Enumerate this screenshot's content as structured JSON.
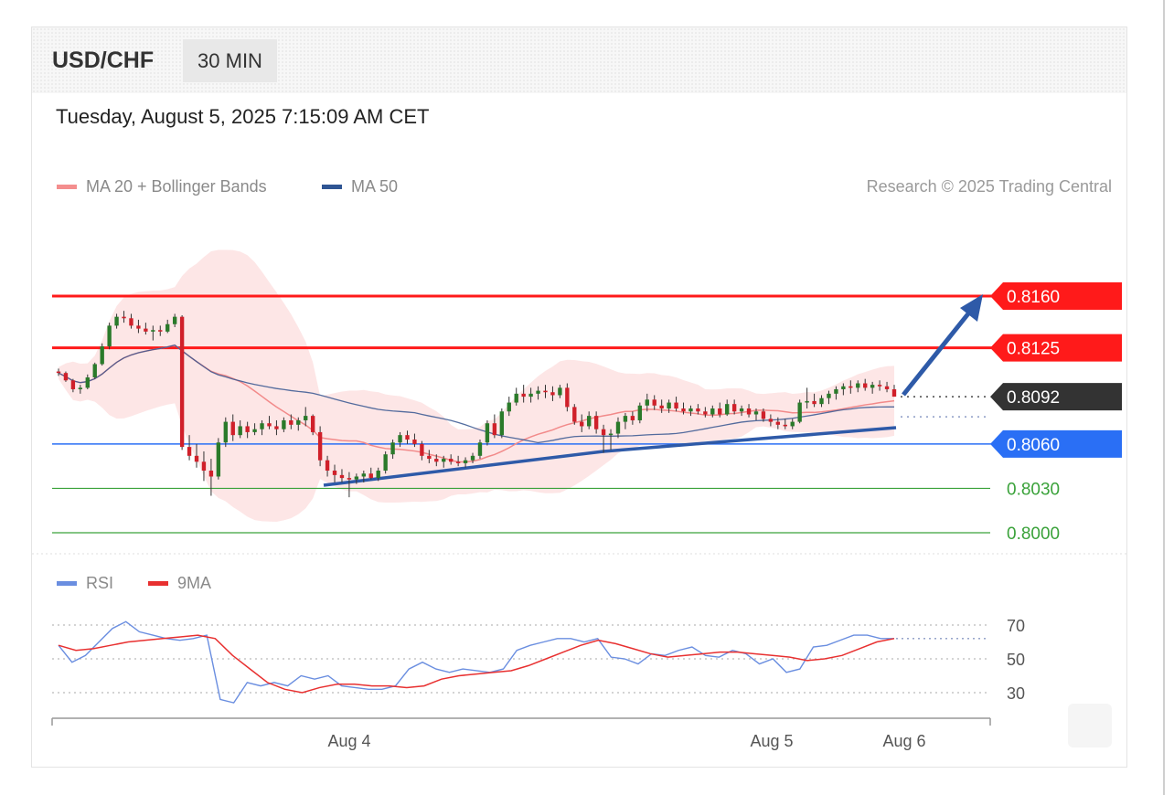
{
  "header": {
    "pair": "USD/CHF",
    "timeframe": "30 MIN",
    "datetime": "Tuesday, August 5, 2025 7:15:09 AM CET"
  },
  "legend": {
    "ma20": "MA 20 + Bollinger Bands",
    "ma50": "MA 50",
    "copyright": "Research © 2025 Trading Central",
    "rsi": "RSI",
    "rsi_ma": "9MA"
  },
  "colors": {
    "resistance": "#ff1a1a",
    "pivot": "#2a6ff5",
    "support": "#3aa23a",
    "last_price": "#333333",
    "ma20": "#f28a8a",
    "ma50": "#35558f",
    "band": "#fde2e2",
    "candle_up": "#2a7a2a",
    "candle_down": "#d0202a",
    "rsi": "#6a8ee0",
    "rsi_ma": "#e83030",
    "arrow": "#2e5aa8"
  },
  "chart_data": {
    "type": "candlestick",
    "title": "USD/CHF 30 MIN",
    "x_ticks": [
      "Aug 4",
      "Aug 5",
      "Aug 6"
    ],
    "levels": [
      {
        "value": 0.816,
        "label": "0.8160",
        "kind": "resistance"
      },
      {
        "value": 0.8125,
        "label": "0.8125",
        "kind": "resistance"
      },
      {
        "value": 0.8092,
        "label": "0.8092",
        "kind": "last_price"
      },
      {
        "value": 0.806,
        "label": "0.8060",
        "kind": "pivot"
      },
      {
        "value": 0.803,
        "label": "0.8030",
        "kind": "support"
      },
      {
        "value": 0.8,
        "label": "0.8000",
        "kind": "support"
      }
    ],
    "candles": [
      [
        0.8109,
        0.8111,
        0.8106,
        0.8108
      ],
      [
        0.8108,
        0.8109,
        0.8102,
        0.8103
      ],
      [
        0.8103,
        0.8104,
        0.8095,
        0.8097
      ],
      [
        0.8097,
        0.81,
        0.8094,
        0.8098
      ],
      [
        0.8098,
        0.8107,
        0.8097,
        0.8105
      ],
      [
        0.8105,
        0.8115,
        0.8104,
        0.8114
      ],
      [
        0.8114,
        0.8128,
        0.8113,
        0.8126
      ],
      [
        0.8126,
        0.8142,
        0.8124,
        0.814
      ],
      [
        0.814,
        0.8148,
        0.8138,
        0.8146
      ],
      [
        0.8146,
        0.815,
        0.8142,
        0.8145
      ],
      [
        0.8145,
        0.8148,
        0.8138,
        0.814
      ],
      [
        0.814,
        0.8144,
        0.8135,
        0.8138
      ],
      [
        0.8138,
        0.8142,
        0.8134,
        0.8136
      ],
      [
        0.8136,
        0.814,
        0.813,
        0.8137
      ],
      [
        0.8137,
        0.814,
        0.8133,
        0.8136
      ],
      [
        0.8136,
        0.8144,
        0.8135,
        0.8141
      ],
      [
        0.8141,
        0.8148,
        0.8139,
        0.8146
      ],
      [
        0.8146,
        0.8147,
        0.8056,
        0.8058
      ],
      [
        0.8058,
        0.8066,
        0.8049,
        0.8052
      ],
      [
        0.8052,
        0.806,
        0.8044,
        0.8048
      ],
      [
        0.8048,
        0.8055,
        0.8035,
        0.8042
      ],
      [
        0.8042,
        0.805,
        0.8025,
        0.8038
      ],
      [
        0.8038,
        0.8064,
        0.8036,
        0.8061
      ],
      [
        0.8061,
        0.8078,
        0.8058,
        0.8075
      ],
      [
        0.8075,
        0.808,
        0.8062,
        0.8066
      ],
      [
        0.8066,
        0.8076,
        0.8064,
        0.8072
      ],
      [
        0.8072,
        0.8075,
        0.8064,
        0.8068
      ],
      [
        0.8068,
        0.8074,
        0.8066,
        0.807
      ],
      [
        0.807,
        0.8076,
        0.8066,
        0.8074
      ],
      [
        0.8074,
        0.8079,
        0.807,
        0.8072
      ],
      [
        0.8072,
        0.8076,
        0.8066,
        0.807
      ],
      [
        0.807,
        0.8078,
        0.8068,
        0.8076
      ],
      [
        0.8076,
        0.808,
        0.807,
        0.8073
      ],
      [
        0.8073,
        0.8078,
        0.8069,
        0.8076
      ],
      [
        0.8076,
        0.8085,
        0.8072,
        0.8079
      ],
      [
        0.8079,
        0.808,
        0.8066,
        0.8068
      ],
      [
        0.8068,
        0.8072,
        0.8045,
        0.8049
      ],
      [
        0.8049,
        0.8052,
        0.8038,
        0.8042
      ],
      [
        0.8042,
        0.8046,
        0.8034,
        0.8039
      ],
      [
        0.8039,
        0.8043,
        0.8034,
        0.8037
      ],
      [
        0.8037,
        0.8041,
        0.8024,
        0.8036
      ],
      [
        0.8036,
        0.804,
        0.8033,
        0.8038
      ],
      [
        0.8038,
        0.8042,
        0.8034,
        0.804
      ],
      [
        0.804,
        0.8044,
        0.8036,
        0.8037
      ],
      [
        0.8037,
        0.8044,
        0.8035,
        0.8042
      ],
      [
        0.8042,
        0.8055,
        0.804,
        0.8053
      ],
      [
        0.8053,
        0.8063,
        0.805,
        0.8061
      ],
      [
        0.8061,
        0.8068,
        0.8058,
        0.8066
      ],
      [
        0.8066,
        0.8069,
        0.806,
        0.8063
      ],
      [
        0.8063,
        0.8067,
        0.8058,
        0.806
      ],
      [
        0.806,
        0.8062,
        0.8049,
        0.8052
      ],
      [
        0.8052,
        0.8056,
        0.8047,
        0.805
      ],
      [
        0.805,
        0.8053,
        0.8045,
        0.8048
      ],
      [
        0.8048,
        0.8052,
        0.8044,
        0.805
      ],
      [
        0.805,
        0.8053,
        0.8046,
        0.8048
      ],
      [
        0.8048,
        0.8052,
        0.8045,
        0.8047
      ],
      [
        0.8047,
        0.8051,
        0.8044,
        0.8049
      ],
      [
        0.8049,
        0.8054,
        0.8047,
        0.8052
      ],
      [
        0.8052,
        0.8063,
        0.805,
        0.8061
      ],
      [
        0.8061,
        0.8076,
        0.8059,
        0.8074
      ],
      [
        0.8074,
        0.808,
        0.8064,
        0.8066
      ],
      [
        0.8066,
        0.8084,
        0.8064,
        0.8082
      ],
      [
        0.8082,
        0.8092,
        0.8079,
        0.8088
      ],
      [
        0.8088,
        0.8098,
        0.8086,
        0.8094
      ],
      [
        0.8094,
        0.81,
        0.8088,
        0.8092
      ],
      [
        0.8092,
        0.8098,
        0.8088,
        0.8094
      ],
      [
        0.8094,
        0.8099,
        0.809,
        0.8096
      ],
      [
        0.8096,
        0.81,
        0.8091,
        0.8095
      ],
      [
        0.8095,
        0.8099,
        0.8089,
        0.8093
      ],
      [
        0.8093,
        0.81,
        0.8091,
        0.8098
      ],
      [
        0.8098,
        0.8101,
        0.8082,
        0.8085
      ],
      [
        0.8085,
        0.8087,
        0.8073,
        0.8075
      ],
      [
        0.8075,
        0.808,
        0.8068,
        0.8072
      ],
      [
        0.8072,
        0.8082,
        0.807,
        0.8079
      ],
      [
        0.8079,
        0.8082,
        0.8067,
        0.807
      ],
      [
        0.807,
        0.8073,
        0.8054,
        0.8066
      ],
      [
        0.8066,
        0.807,
        0.8056,
        0.8067
      ],
      [
        0.8067,
        0.8078,
        0.8064,
        0.8075
      ],
      [
        0.8075,
        0.8081,
        0.807,
        0.8079
      ],
      [
        0.8079,
        0.8082,
        0.8073,
        0.8076
      ],
      [
        0.8076,
        0.8088,
        0.8074,
        0.8086
      ],
      [
        0.8086,
        0.8094,
        0.8082,
        0.809
      ],
      [
        0.809,
        0.8093,
        0.8083,
        0.8086
      ],
      [
        0.8086,
        0.809,
        0.8081,
        0.8084
      ],
      [
        0.8084,
        0.809,
        0.8081,
        0.8088
      ],
      [
        0.8088,
        0.8092,
        0.8082,
        0.8084
      ],
      [
        0.8084,
        0.8088,
        0.808,
        0.8082
      ],
      [
        0.8082,
        0.8086,
        0.8079,
        0.8084
      ],
      [
        0.8084,
        0.8087,
        0.808,
        0.8082
      ],
      [
        0.8082,
        0.8085,
        0.8078,
        0.808
      ],
      [
        0.808,
        0.8086,
        0.8078,
        0.8084
      ],
      [
        0.8084,
        0.8088,
        0.8078,
        0.808
      ],
      [
        0.808,
        0.809,
        0.8079,
        0.8087
      ],
      [
        0.8087,
        0.809,
        0.808,
        0.8082
      ],
      [
        0.8082,
        0.8086,
        0.8079,
        0.8084
      ],
      [
        0.8084,
        0.8087,
        0.8078,
        0.808
      ],
      [
        0.808,
        0.8084,
        0.8076,
        0.8082
      ],
      [
        0.8082,
        0.8084,
        0.8075,
        0.8077
      ],
      [
        0.8077,
        0.808,
        0.8072,
        0.8075
      ],
      [
        0.8075,
        0.8078,
        0.807,
        0.8073
      ],
      [
        0.8073,
        0.8077,
        0.807,
        0.8072
      ],
      [
        0.8072,
        0.8077,
        0.807,
        0.8075
      ],
      [
        0.8075,
        0.809,
        0.8074,
        0.8088
      ],
      [
        0.8088,
        0.8098,
        0.8084,
        0.8089
      ],
      [
        0.8089,
        0.8094,
        0.8085,
        0.8087
      ],
      [
        0.8087,
        0.8093,
        0.8085,
        0.8091
      ],
      [
        0.8091,
        0.8096,
        0.8087,
        0.8094
      ],
      [
        0.8094,
        0.8099,
        0.809,
        0.8097
      ],
      [
        0.8097,
        0.8101,
        0.8093,
        0.8099
      ],
      [
        0.8099,
        0.8103,
        0.8094,
        0.8098
      ],
      [
        0.8098,
        0.8103,
        0.8095,
        0.8101
      ],
      [
        0.8101,
        0.8104,
        0.8096,
        0.8098
      ],
      [
        0.8098,
        0.8102,
        0.8094,
        0.81
      ],
      [
        0.81,
        0.8103,
        0.8096,
        0.8099
      ],
      [
        0.8099,
        0.8102,
        0.8095,
        0.8097
      ],
      [
        0.8097,
        0.81,
        0.8092,
        0.8092
      ]
    ],
    "price_range": [
      0.799,
      0.82
    ],
    "rsi": {
      "reference_lines": [
        70,
        50,
        30
      ],
      "rsi_values": [
        58,
        48,
        52,
        60,
        68,
        72,
        66,
        64,
        62,
        61,
        62,
        64,
        26,
        24,
        36,
        34,
        36,
        34,
        40,
        38,
        40,
        34,
        33,
        32,
        32,
        34,
        44,
        48,
        44,
        42,
        44,
        43,
        42,
        44,
        55,
        58,
        60,
        62,
        62,
        60,
        62,
        51,
        50,
        47,
        53,
        52,
        55,
        57,
        52,
        51,
        55,
        53,
        47,
        50,
        42,
        44,
        57,
        58,
        61,
        64,
        64,
        62,
        62
      ],
      "ma_values": [
        58,
        55,
        56,
        58,
        60,
        61,
        62,
        63,
        64,
        62,
        52,
        44,
        36,
        32,
        30,
        33,
        35,
        35,
        34,
        34,
        33,
        34,
        38,
        40,
        41,
        42,
        43,
        46,
        50,
        54,
        58,
        61,
        59,
        56,
        53,
        51,
        52,
        53,
        54,
        54,
        53,
        52,
        51,
        49,
        50,
        52,
        56,
        60,
        62
      ]
    }
  }
}
